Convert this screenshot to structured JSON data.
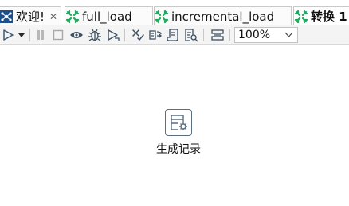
{
  "tabs": [
    {
      "label": "欢迎!",
      "icon": "welcome-icon",
      "closable": true
    },
    {
      "label": "full_load",
      "icon": "transformation-icon"
    },
    {
      "label": "incremental_load",
      "icon": "transformation-icon"
    },
    {
      "label": "转换 1",
      "icon": "transformation-icon",
      "active": true
    }
  ],
  "tab_close_glyph": "✕",
  "toolbar": {
    "icons": [
      "run-icon",
      "run-options-dropdown-icon",
      "pause-icon",
      "stop-icon",
      "preview-icon",
      "debug-icon",
      "replay-icon",
      "verify-icon",
      "impact-analysis-icon",
      "sql-icon",
      "explore-database-icon",
      "show-results-icon"
    ],
    "zoom_value": "100%",
    "zoom_options": [
      "100%"
    ]
  },
  "canvas": {
    "steps": [
      {
        "label": "生成记录",
        "icon": "generate-rows-icon"
      }
    ]
  },
  "colors": {
    "transformation_icon": "#1faa5b",
    "step_border": "#5a6f80",
    "icon_gray": "#4a5a6a"
  }
}
